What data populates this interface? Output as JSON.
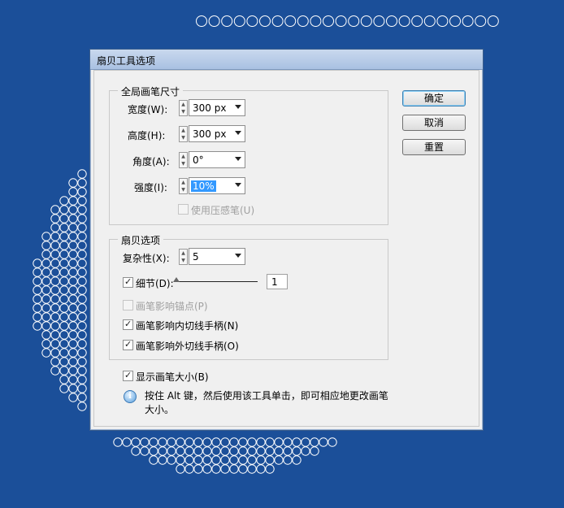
{
  "dialog": {
    "title": "扇贝工具选项"
  },
  "global_brush": {
    "legend": "全局画笔尺寸",
    "width": {
      "label": "宽度(W):",
      "value": "300 px"
    },
    "height": {
      "label": "高度(H):",
      "value": "300 px"
    },
    "angle": {
      "label": "角度(A):",
      "value": "0°"
    },
    "intensity": {
      "label": "强度(I):",
      "value": "10%"
    },
    "use_pressure": {
      "label": "使用压感笔(U)",
      "checked": false,
      "enabled": false
    }
  },
  "scallop": {
    "legend": "扇贝选项",
    "complexity": {
      "label": "复杂性(X):",
      "value": "5"
    },
    "detail": {
      "label": "细节(D):",
      "value": "1",
      "checked": true
    },
    "brush_affects_anchor": {
      "label": "画笔影响锚点(P)",
      "checked": false,
      "enabled": false
    },
    "brush_affects_in_tangent": {
      "label": "画笔影响内切线手柄(N)",
      "checked": true
    },
    "brush_affects_out_tangent": {
      "label": "画笔影响外切线手柄(O)",
      "checked": true
    }
  },
  "show_brush_size": {
    "label": "显示画笔大小(B)",
    "checked": true
  },
  "hint": {
    "line1": "按住 Alt 键，然后使用该工具单击，即可相应地更改画笔",
    "line2": "大小。"
  },
  "buttons": {
    "ok": "确定",
    "cancel": "取消",
    "reset": "重置"
  },
  "colors": {
    "canvas_bg": "#1b4f99",
    "circle_stroke": "#ffffff",
    "accent": "#3399ff"
  },
  "icons": {
    "spin": "up-down-arrows",
    "dropdown": "chevron-down",
    "info": "info-icon"
  }
}
